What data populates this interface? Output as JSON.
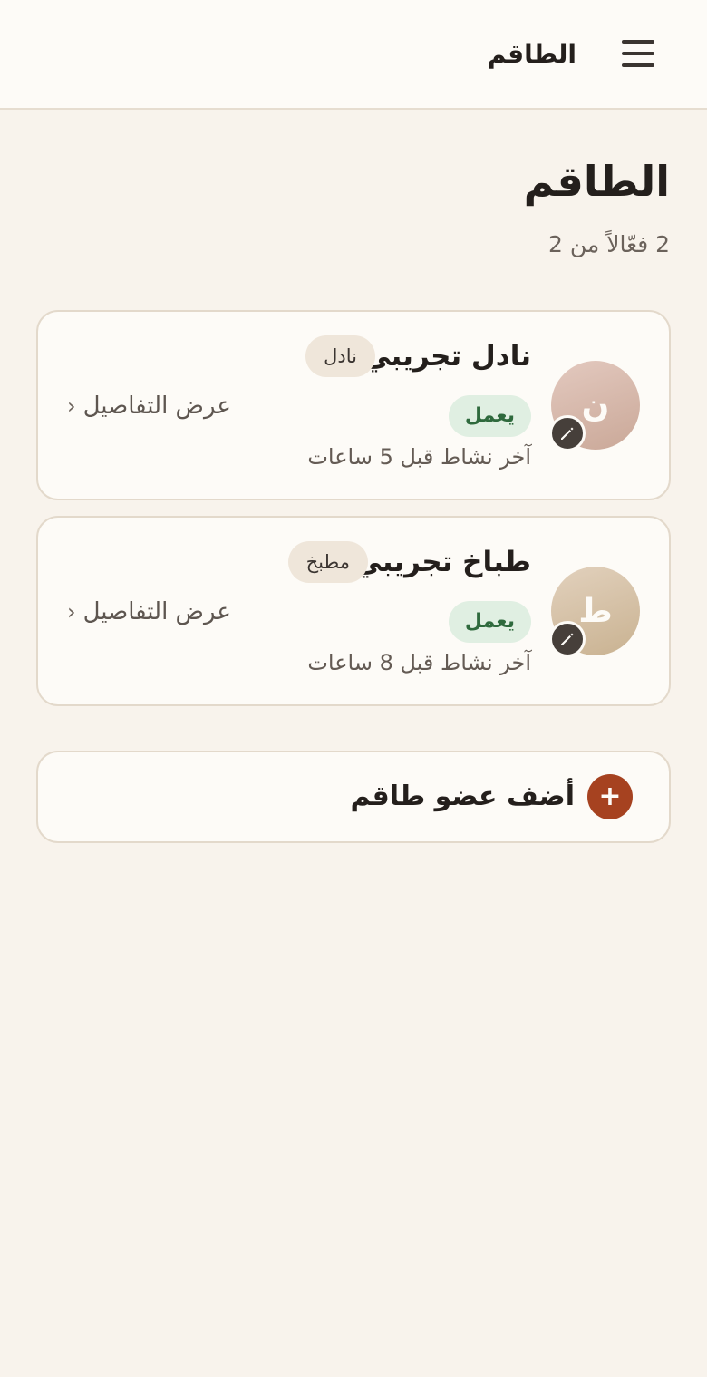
{
  "header": {
    "title": "الطاقم",
    "menu_icon": "hamburger-menu-icon"
  },
  "page": {
    "title": "الطاقم",
    "subtitle": "2 فعّالاً من 2"
  },
  "members": [
    {
      "initial": "ن",
      "name": "نادل تجريبي",
      "role": "نادل",
      "status": "يعمل",
      "last_active": "آخر نشاط قبل 5 ساعات",
      "details_label": "عرض التفاصيل",
      "edit_icon": "pencil-icon"
    },
    {
      "initial": "ط",
      "name": "طباخ تجريبي",
      "role": "مطبخ",
      "status": "يعمل",
      "last_active": "آخر نشاط قبل 8 ساعات",
      "details_label": "عرض التفاصيل",
      "edit_icon": "pencil-icon"
    }
  ],
  "add_member": {
    "label": "أضف عضو طاقم",
    "icon": "plus-icon",
    "icon_glyph": "+"
  },
  "colors": {
    "background": "#f8f3ec",
    "surface": "#fdfbf7",
    "accent": "#a64220",
    "status_bg": "#e0efe2",
    "status_text": "#2f6a3d"
  }
}
